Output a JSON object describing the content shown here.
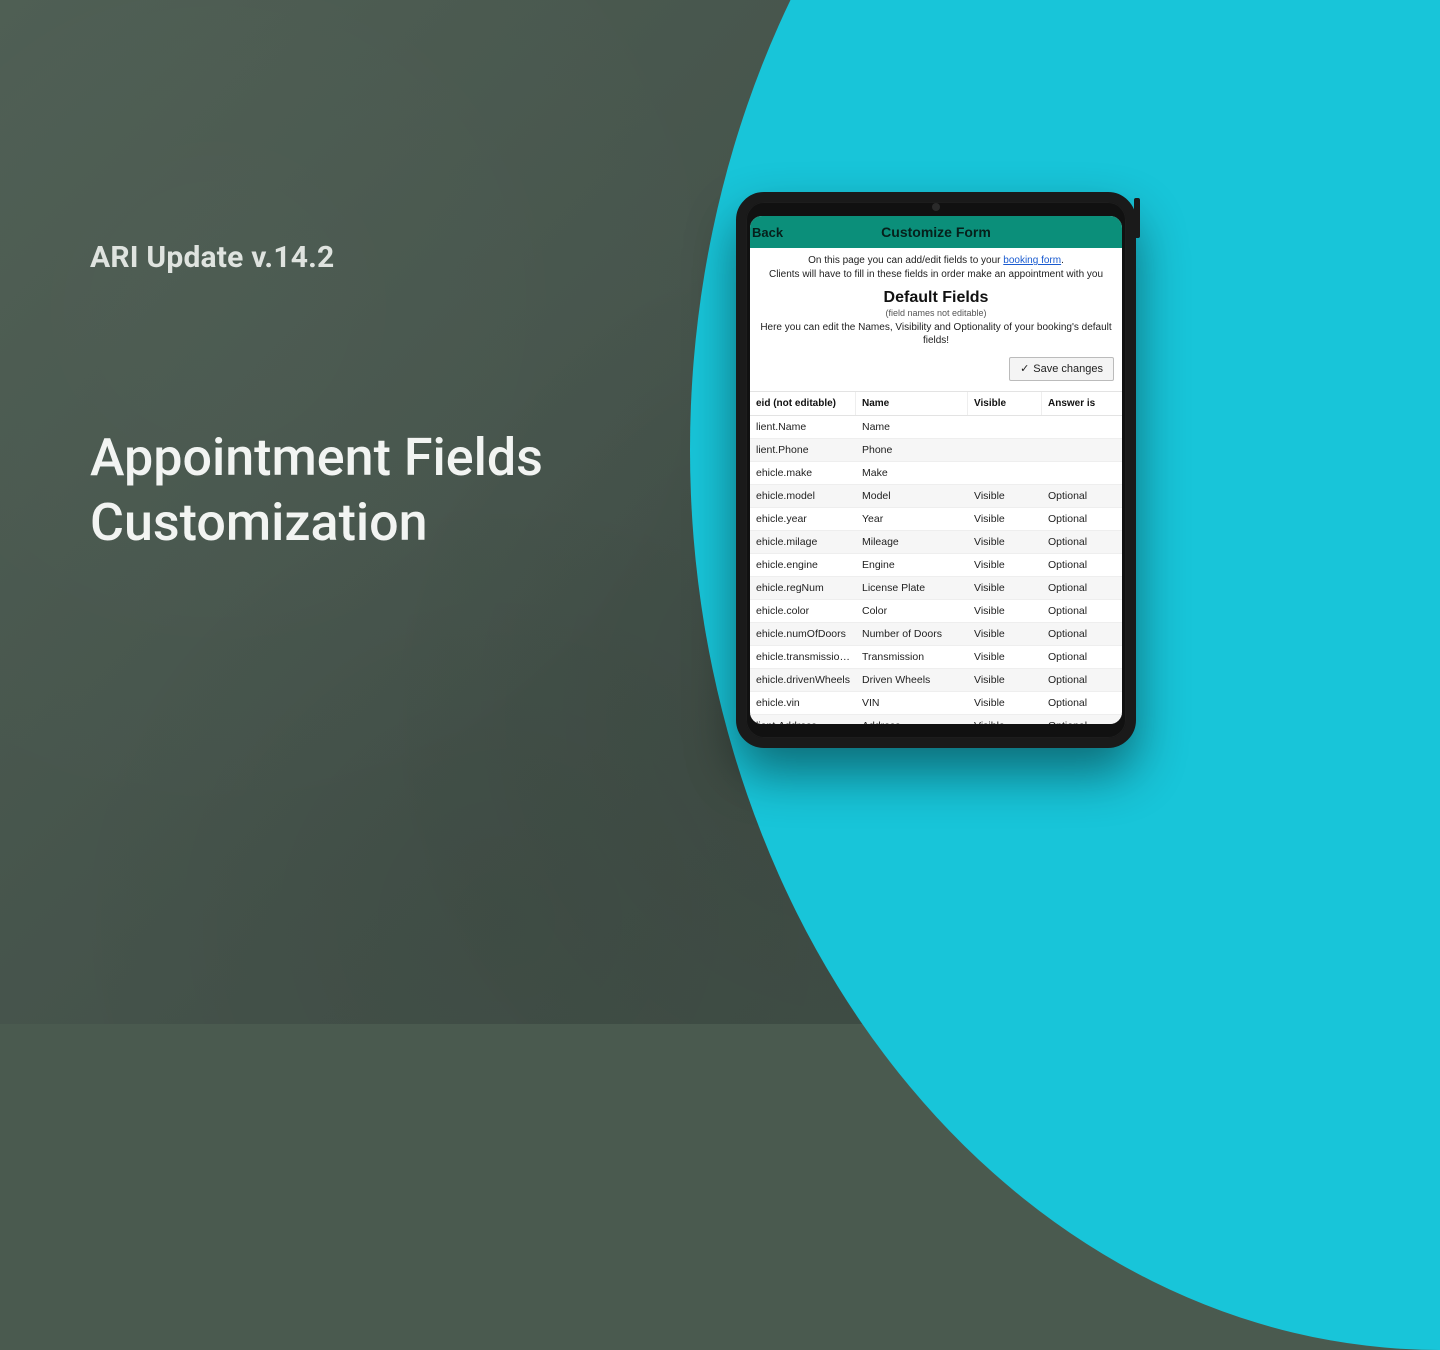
{
  "page": {
    "subtitle": "ARI Update v.14.2",
    "title_line1": "Appointment Fields",
    "title_line2": "Customization"
  },
  "app": {
    "back_label": "Back",
    "header_title": "Customize Form",
    "intro_prefix": "On this page you can add/edit fields to your ",
    "intro_link": "booking form",
    "intro_suffix": ".",
    "intro_line2": "Clients will have to fill in these fields in order make an appointment with you",
    "section_title": "Default Fields",
    "section_sub": "(field names not editable)",
    "section_desc": "Here you can edit the Names, Visibility and Optionality of your booking's default fields!",
    "save_label": "Save changes",
    "columns": {
      "id": "eid (not editable)",
      "name": "Name",
      "visible": "Visible",
      "answer": "Answer is"
    },
    "rows": [
      {
        "id": "lient.Name",
        "name": "Name",
        "visible": "",
        "answer": ""
      },
      {
        "id": "lient.Phone",
        "name": "Phone",
        "visible": "",
        "answer": ""
      },
      {
        "id": "ehicle.make",
        "name": "Make",
        "visible": "",
        "answer": ""
      },
      {
        "id": "ehicle.model",
        "name": "Model",
        "visible": "Visible",
        "answer": "Optional"
      },
      {
        "id": "ehicle.year",
        "name": "Year",
        "visible": "Visible",
        "answer": "Optional"
      },
      {
        "id": "ehicle.milage",
        "name": "Mileage",
        "visible": "Visible",
        "answer": "Optional"
      },
      {
        "id": "ehicle.engine",
        "name": "Engine",
        "visible": "Visible",
        "answer": "Optional"
      },
      {
        "id": "ehicle.regNum",
        "name": "License Plate",
        "visible": "Visible",
        "answer": "Optional"
      },
      {
        "id": "ehicle.color",
        "name": "Color",
        "visible": "Visible",
        "answer": "Optional"
      },
      {
        "id": "ehicle.numOfDoors",
        "name": "Number of Doors",
        "visible": "Visible",
        "answer": "Optional"
      },
      {
        "id": "ehicle.transmission...",
        "name": "Transmission",
        "visible": "Visible",
        "answer": "Optional"
      },
      {
        "id": "ehicle.drivenWheels",
        "name": "Driven Wheels",
        "visible": "Visible",
        "answer": "Optional"
      },
      {
        "id": "ehicle.vin",
        "name": "VIN",
        "visible": "Visible",
        "answer": "Optional"
      },
      {
        "id": "lient.Address",
        "name": "Address",
        "visible": "Visible",
        "answer": "Optional"
      }
    ]
  }
}
